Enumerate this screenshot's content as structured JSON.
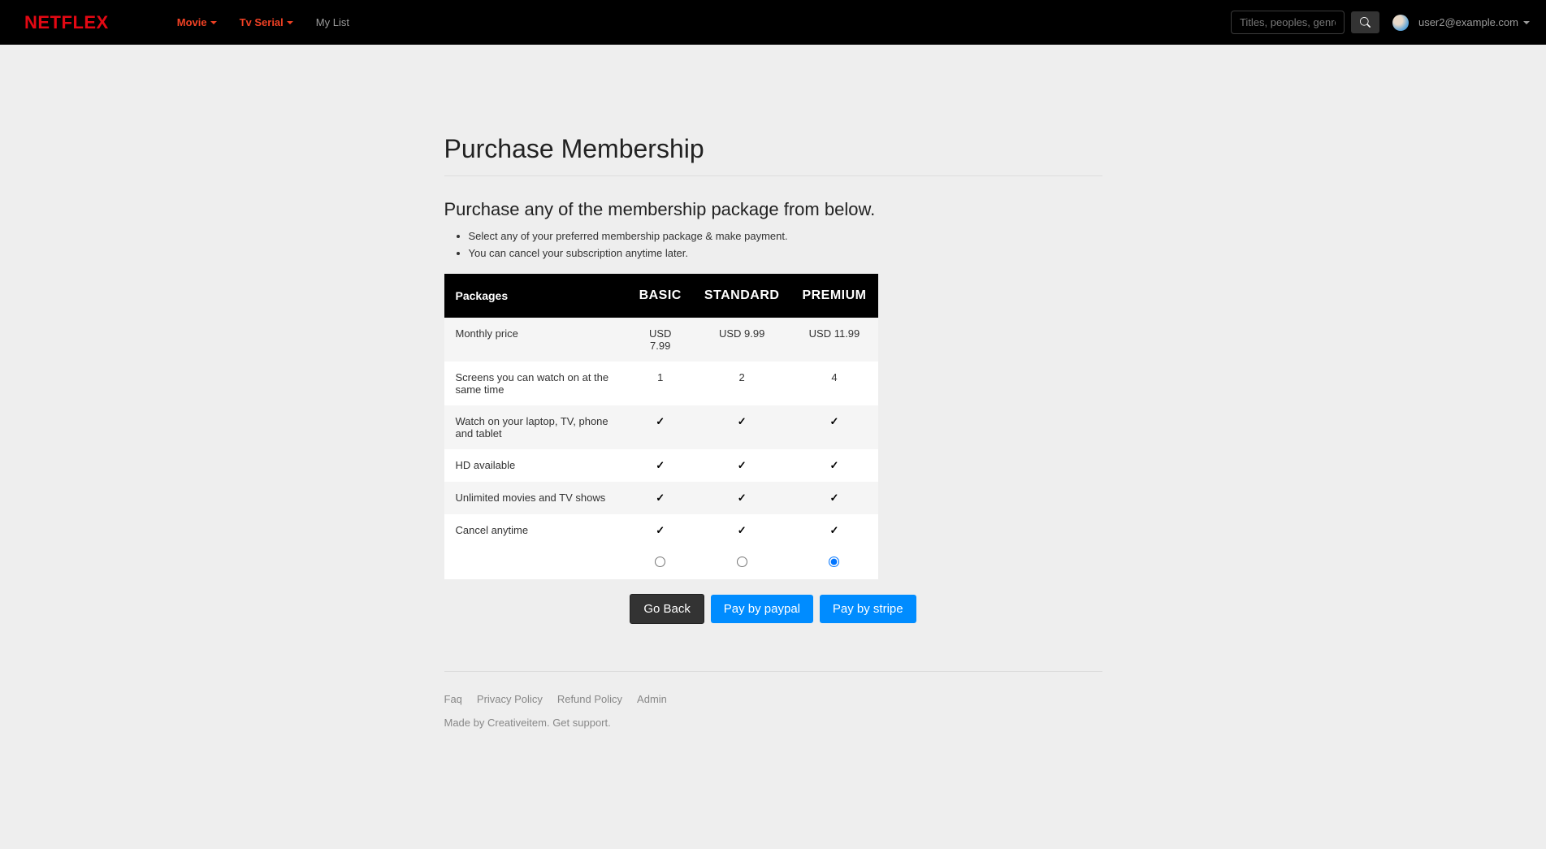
{
  "brand": "NETFLEX",
  "nav": {
    "movie": "Movie",
    "tvserial": "Tv Serial",
    "mylist": "My List"
  },
  "search": {
    "placeholder": "Titles, peoples, genres"
  },
  "user": {
    "email": "user2@example.com"
  },
  "page": {
    "title": "Purchase Membership",
    "subtitle": "Purchase any of the membership package from below.",
    "instructions": [
      "Select any of your preferred membership package & make payment.",
      "You can cancel your subscription anytime later."
    ]
  },
  "table": {
    "header_label": "Packages",
    "plans": [
      "BASIC",
      "STANDARD",
      "PREMIUM"
    ],
    "rows": [
      {
        "label": "Monthly price",
        "values": [
          "USD 7.99",
          "USD 9.99",
          "USD 11.99"
        ]
      },
      {
        "label": "Screens you can watch on at the same time",
        "values": [
          "1",
          "2",
          "4"
        ]
      },
      {
        "label": "Watch on your laptop, TV, phone and tablet",
        "check": true
      },
      {
        "label": "HD available",
        "check": true
      },
      {
        "label": "Unlimited movies and TV shows",
        "check": true
      },
      {
        "label": "Cancel anytime",
        "check": true
      }
    ],
    "selected_plan_index": 2
  },
  "buttons": {
    "goback": "Go Back",
    "paypal": "Pay by paypal",
    "stripe": "Pay by stripe"
  },
  "footer": {
    "links": [
      "Faq",
      "Privacy Policy",
      "Refund Policy",
      "Admin"
    ],
    "madeby_prefix": "Made by ",
    "madeby_link1": "Creativeitem",
    "madeby_sep": ". ",
    "madeby_link2": "Get support.",
    "madeby_suffix": ""
  }
}
